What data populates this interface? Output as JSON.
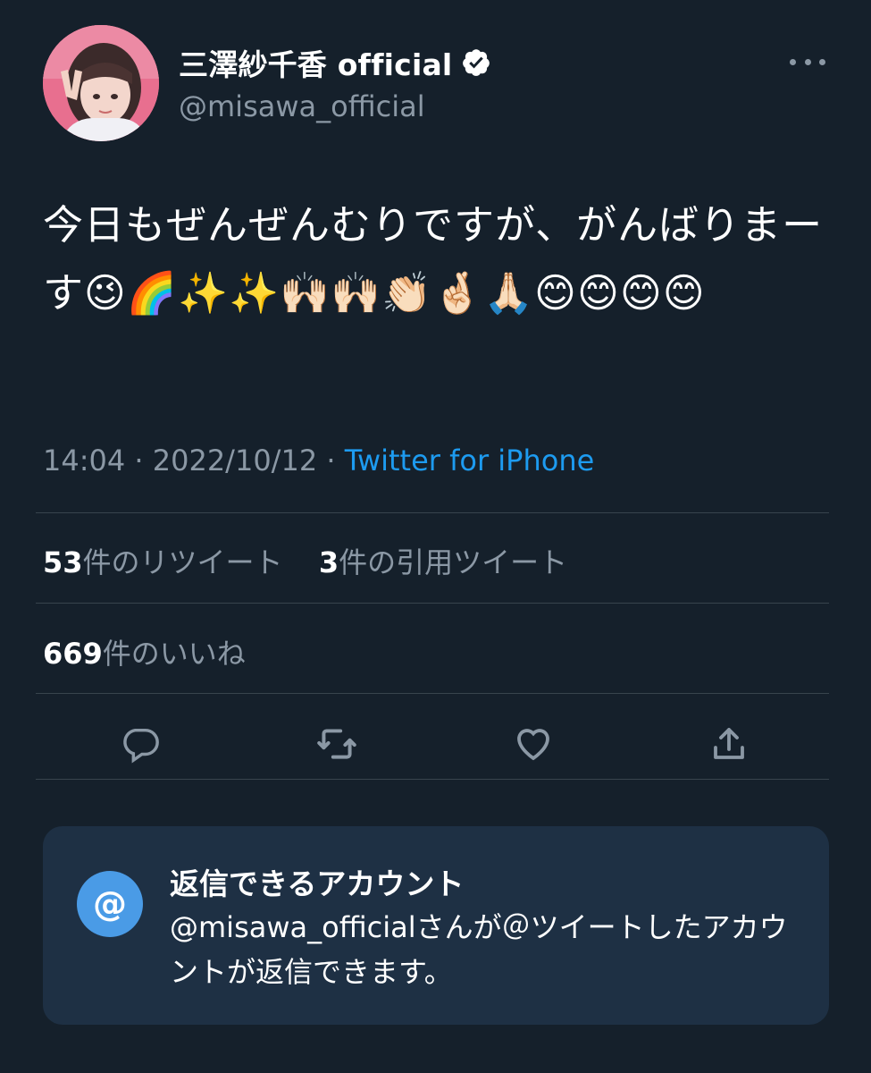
{
  "author": {
    "display_name": "三澤紗千香 official",
    "handle": "@misawa_official",
    "verified_icon": "verified-badge-icon",
    "avatar_icon": "profile-photo"
  },
  "menu": {
    "more_icon": "more-horizontal-icon"
  },
  "tweet": {
    "text": "今日もぜんぜんむりですが、がんばりまーす😉🌈✨✨🙌🏻🙌🏻👏🏻🤞🏻🙏🏻😊😊😊😊",
    "time": "14:04",
    "date": "2022/10/12",
    "separator": "·",
    "source": "Twitter for iPhone"
  },
  "stats": {
    "retweets_count": "53",
    "retweets_label": "件のリツイート",
    "quotes_count": "3",
    "quotes_label": "件の引用ツイート",
    "likes_count": "669",
    "likes_label": "件のいいね"
  },
  "actions": [
    {
      "name": "reply",
      "icon": "reply-icon"
    },
    {
      "name": "retweet",
      "icon": "retweet-icon"
    },
    {
      "name": "like",
      "icon": "heart-icon"
    },
    {
      "name": "share",
      "icon": "share-icon"
    }
  ],
  "reply_restriction": {
    "icon_glyph": "@",
    "title": "返信できるアカウント",
    "body_handle": "@misawa_official",
    "body_text": "さんが＠ツイートしたアカウントが返信できます。"
  },
  "colors": {
    "background": "#15202b",
    "text_secondary": "#8b98a5",
    "accent": "#1d9bf0",
    "card_bg": "#1e3044",
    "divider": "#38444d"
  }
}
